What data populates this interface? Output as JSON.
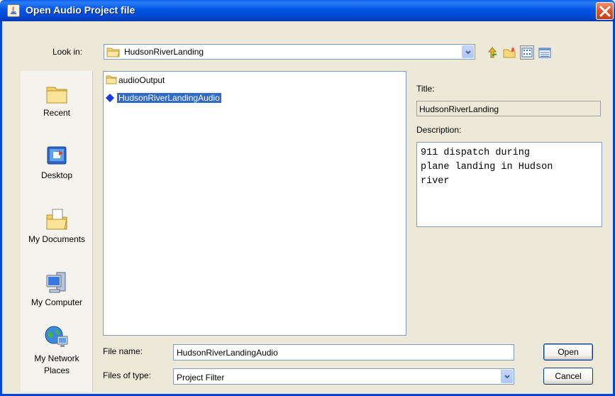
{
  "window": {
    "title": "Open Audio Project file",
    "close_icon": "close-icon"
  },
  "lookin": {
    "label": "Look in:",
    "value": "HudsonRiverLanding"
  },
  "toolbar": {
    "icons": [
      "up-folder-icon",
      "new-folder-icon",
      "list-view-icon",
      "details-view-icon"
    ]
  },
  "places": [
    {
      "label": "Recent",
      "icon": "recent-folder-icon"
    },
    {
      "label": "Desktop",
      "icon": "desktop-icon"
    },
    {
      "label": "My Documents",
      "icon": "my-documents-icon"
    },
    {
      "label": "My Computer",
      "icon": "my-computer-icon"
    },
    {
      "label": "My Network\nPlaces",
      "icon": "network-places-icon"
    }
  ],
  "files": [
    {
      "name": "audioOutput",
      "type": "folder",
      "selected": false
    },
    {
      "name": "HudsonRiverLandingAudio",
      "type": "project",
      "selected": true
    }
  ],
  "accessory": {
    "title_label": "Title:",
    "title_value": "HudsonRiverLanding",
    "description_label": "Description:",
    "description_value": "911 dispatch during\nplane landing in Hudson\nriver"
  },
  "filename": {
    "label": "File name:",
    "value": "HudsonRiverLandingAudio"
  },
  "filetype": {
    "label": "Files of type:",
    "value": "Project Filter"
  },
  "buttons": {
    "open": "Open",
    "cancel": "Cancel"
  },
  "colors": {
    "titlebar": "#0055e5",
    "selection": "#316ac5",
    "dialog_bg": "#ece9d8"
  }
}
